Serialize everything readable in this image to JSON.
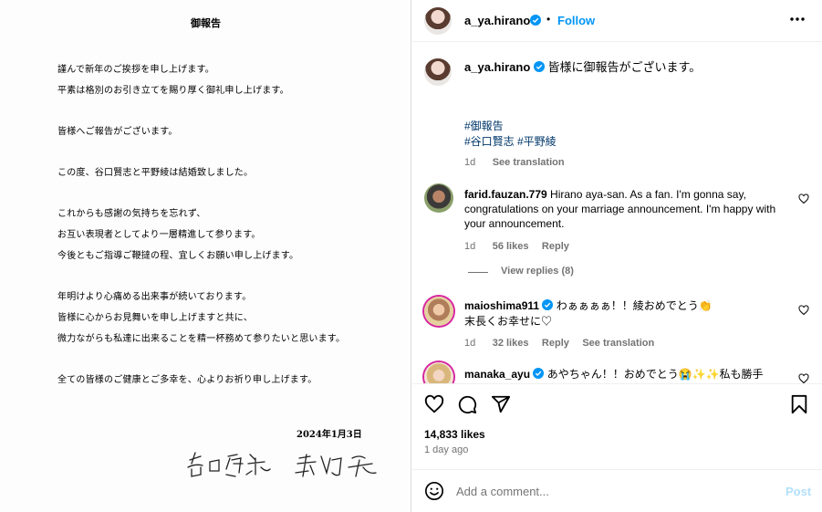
{
  "letter": {
    "title": "御報告",
    "lines": [
      "謹んで新年のご挨拶を申し上げます。",
      "平素は格別のお引き立てを賜り厚く御礼申し上げます。",
      "皆様へご報告がございます。",
      "この度、谷口賢志と平野綾は結婚致しました。",
      "これからも感謝の気持ちを忘れず、",
      "お互い表現者としてより一層精進して参ります。",
      "今後ともご指導ご鞭撻の程、宜しくお願い申し上げます。",
      "年明けより心痛める出来事が続いております。",
      "皆様に心からお見舞いを申し上げますと共に、",
      "微力ながらも私達に出来ることを精一杯務めて参りたいと思います。",
      "全ての皆様のご健康とご多幸を、心よりお祈り申し上げます。"
    ],
    "date": "2024年1月3日",
    "signature": "谷口賢志 平野綾"
  },
  "header": {
    "username": "a_ya.hirano",
    "separator": "•",
    "follow_label": "Follow",
    "more_icon": "more-horizontal-icon"
  },
  "caption": {
    "username": "a_ya.hirano",
    "text": "皆様に御報告がございます。",
    "hashtags": [
      "#御報告",
      "#谷口賢志 #平野綾"
    ],
    "time": "1d",
    "see_translation": "See translation"
  },
  "comments": [
    {
      "username": "farid.fauzan.779",
      "text": "Hirano aya-san. As a fan. I'm gonna say, congratulations on your marriage announcement. I'm happy with your announcement.",
      "time": "1d",
      "likes": "56 likes",
      "reply": "Reply",
      "view_replies": "View replies (8)"
    },
    {
      "username": "maioshima911",
      "text_line1": "わぁぁぁぁ！！綾おめでとう👏",
      "text_line2": "末長くお幸せに♡",
      "time": "1d",
      "likes": "32 likes",
      "reply": "Reply",
      "see_translation": "See translation"
    },
    {
      "username": "manaka_ayu",
      "text": "あやちゃん！！おめでとう😭✨✨私も勝手"
    }
  ],
  "actions": {
    "likes": "14,833 likes",
    "posted": "1 day ago"
  },
  "comment_box": {
    "placeholder": "Add a comment...",
    "post_label": "Post"
  },
  "colors": {
    "link_blue": "#0095f6",
    "hashtag": "#00376b",
    "muted": "#737373",
    "verified": "#0095f6"
  }
}
